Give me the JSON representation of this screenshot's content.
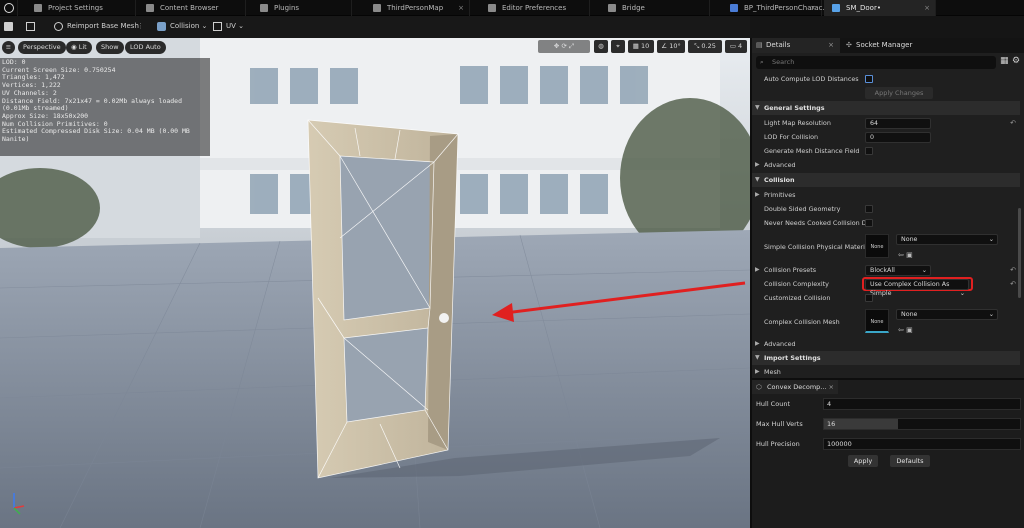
{
  "tabs": [
    {
      "label": "Project Settings",
      "active": false,
      "closable": false
    },
    {
      "label": "Content Browser",
      "active": false,
      "closable": false
    },
    {
      "label": "Plugins",
      "active": false,
      "closable": false
    },
    {
      "label": "ThirdPersonMap",
      "active": false,
      "closable": true
    },
    {
      "label": "Editor Preferences",
      "active": false,
      "closable": false
    },
    {
      "label": "Bridge",
      "active": false,
      "closable": false
    },
    {
      "label": "BP_ThirdPersonCharac...",
      "active": false,
      "closable": true
    },
    {
      "label": "SM_Door•",
      "active": true,
      "closable": true
    }
  ],
  "toolbar": {
    "reimport": "Reimport Base Mesh",
    "collision": "Collision",
    "uv": "UV"
  },
  "viewport": {
    "perspective": "Perspective",
    "lit": "Lit",
    "show": "Show",
    "lod": "LOD Auto",
    "grid_value": "10",
    "angle_value": "10°",
    "scale_value": "0.25",
    "camera_speed": "4",
    "stats": [
      "LOD:  0",
      "Current Screen Size:  0.750254",
      "Triangles:  1,472",
      "Vertices:  1,222",
      "UV Channels:  2",
      "Distance Field:  7x21x47 = 0.02Mb always loaded (0.01Mb streamed)",
      "Approx Size: 18x50x200",
      "Num Collision Primitives:  0",
      "Estimated Compressed Disk Size: 0.04 MB (0.00 MB Nanite)"
    ]
  },
  "details": {
    "tab_details": "Details",
    "tab_socket": "Socket Manager",
    "search_placeholder": "Search",
    "auto_lod_label": "Auto Compute LOD Distances",
    "apply_changes": "Apply Changes",
    "general_settings": "General Settings",
    "light_map_label": "Light Map Resolution",
    "light_map_value": "64",
    "lod_collision_label": "LOD For Collision",
    "lod_collision_value": "0",
    "gen_mesh_df_label": "Generate Mesh Distance Field",
    "advanced": "Advanced",
    "collision": "Collision",
    "primitives": "Primitives",
    "double_sided_label": "Double Sided Geometry",
    "never_cooked_label": "Never Needs Cooked Collision D...",
    "phys_material_label": "Simple Collision Physical Material",
    "thumb_none": "None",
    "phys_material_value": "None",
    "presets_label": "Collision Presets",
    "presets_value": "BlockAll",
    "complexity_label": "Collision Complexity",
    "complexity_value": "Use Complex Collision As Simple",
    "customized_label": "Customized Collision",
    "complex_mesh_label": "Complex Collision Mesh",
    "complex_mesh_value": "None",
    "advanced2": "Advanced",
    "import_settings": "Import Settings",
    "mesh": "Mesh"
  },
  "convex": {
    "tab": "Convex Decomp...",
    "hull_count_label": "Hull Count",
    "hull_count": "4",
    "max_verts_label": "Max Hull Verts",
    "max_verts": "16",
    "precision_label": "Hull Precision",
    "precision": "100000",
    "apply": "Apply",
    "defaults": "Defaults"
  },
  "colors": {
    "accent": "#e02020",
    "active_tab": "#242424"
  }
}
